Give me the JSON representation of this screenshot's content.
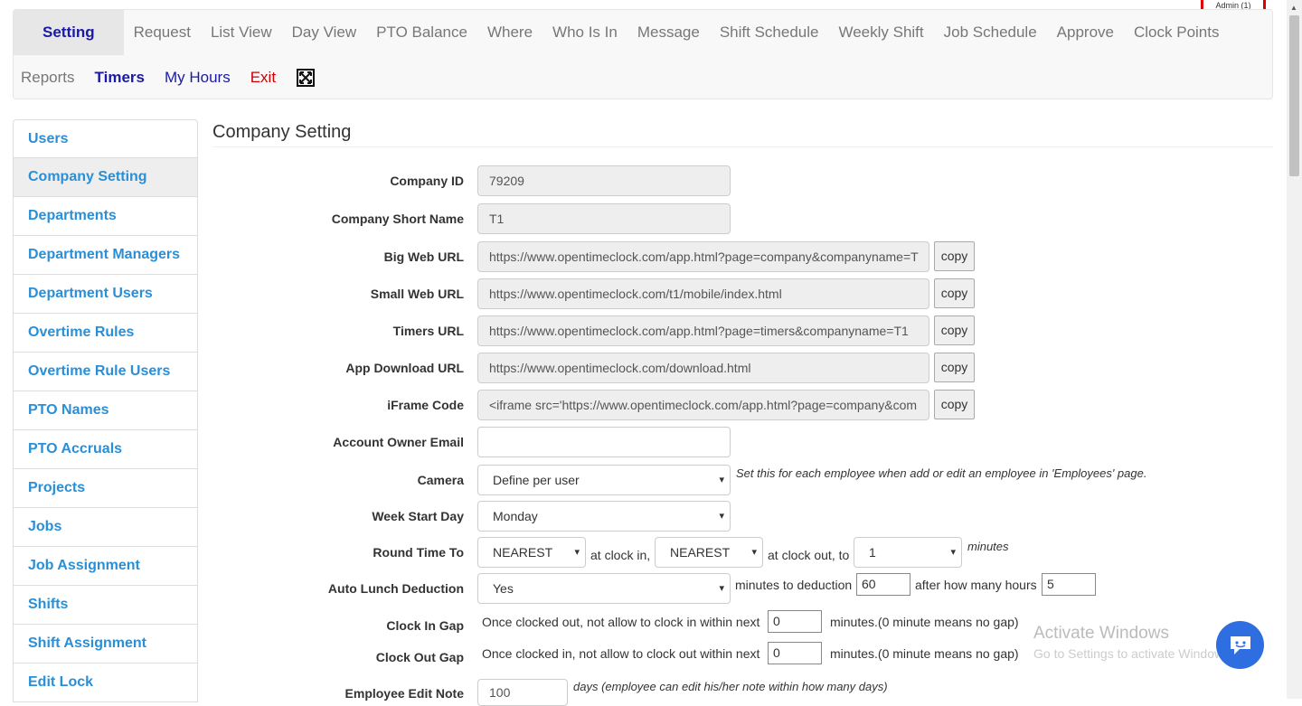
{
  "admin_badge": "Admin (1)",
  "nav": {
    "row1": [
      "Setting",
      "Request",
      "List View",
      "Day View",
      "PTO Balance",
      "Where",
      "Who Is In",
      "Message",
      "Shift Schedule",
      "Weekly Shift",
      "Job Schedule",
      "Approve",
      "Clock Points"
    ],
    "row2": [
      "Reports",
      "Timers",
      "My Hours",
      "Exit"
    ],
    "fullscreen_icon": "fullscreen-icon"
  },
  "sidebar": {
    "items": [
      "Users",
      "Company Setting",
      "Departments",
      "Department Managers",
      "Department Users",
      "Overtime Rules",
      "Overtime Rule Users",
      "PTO Names",
      "PTO Accruals",
      "Projects",
      "Jobs",
      "Job Assignment",
      "Shifts",
      "Shift Assignment",
      "Edit Lock"
    ],
    "active": "Company Setting"
  },
  "main": {
    "title": "Company Setting",
    "copy_label": "copy",
    "fields": {
      "company_id": {
        "label": "Company ID",
        "value": "79209"
      },
      "short_name": {
        "label": "Company Short Name",
        "value": "T1"
      },
      "big_web_url": {
        "label": "Big Web URL",
        "value": "https://www.opentimeclock.com/app.html?page=company&companyname=T"
      },
      "small_web_url": {
        "label": "Small Web URL",
        "value": "https://www.opentimeclock.com/t1/mobile/index.html"
      },
      "timers_url": {
        "label": "Timers URL",
        "value": "https://www.opentimeclock.com/app.html?page=timers&companyname=T1"
      },
      "app_download_url": {
        "label": "App Download URL",
        "value": "https://www.opentimeclock.com/download.html"
      },
      "iframe_code": {
        "label": "iFrame Code",
        "value": "<iframe src='https://www.opentimeclock.com/app.html?page=company&com"
      },
      "owner_email": {
        "label": "Account Owner Email",
        "value": ""
      },
      "camera": {
        "label": "Camera",
        "value": "Define per user",
        "hint": "Set this for each employee when add or edit an employee in 'Employees' page."
      },
      "week_start": {
        "label": "Week Start Day",
        "value": "Monday"
      },
      "round_time": {
        "label": "Round Time To",
        "clock_in_value": "NEAREST",
        "text_in": "at clock in,",
        "clock_out_value": "NEAREST",
        "text_out": "at clock out, to",
        "minutes_value": "1",
        "unit": "minutes"
      },
      "auto_lunch": {
        "label": "Auto Lunch Deduction",
        "value": "Yes",
        "text1": "minutes to deduction",
        "minutes": "60",
        "text2": "after how many hours",
        "hours": "5"
      },
      "clock_in_gap": {
        "label": "Clock In Gap",
        "text": "Once clocked out, not allow to clock in within next",
        "value": "0",
        "suffix": "minutes.(0 minute means no gap)"
      },
      "clock_out_gap": {
        "label": "Clock Out Gap",
        "text": "Once clocked in, not allow to clock out within next",
        "value": "0",
        "suffix": "minutes.(0 minute means no gap)"
      },
      "edit_note": {
        "label": "Employee Edit Note",
        "value": "100",
        "hint": "days (employee can edit his/her note within how many days)"
      }
    }
  },
  "watermark": {
    "line1": "Activate Windows",
    "line2": "Go to Settings to activate Windows."
  }
}
